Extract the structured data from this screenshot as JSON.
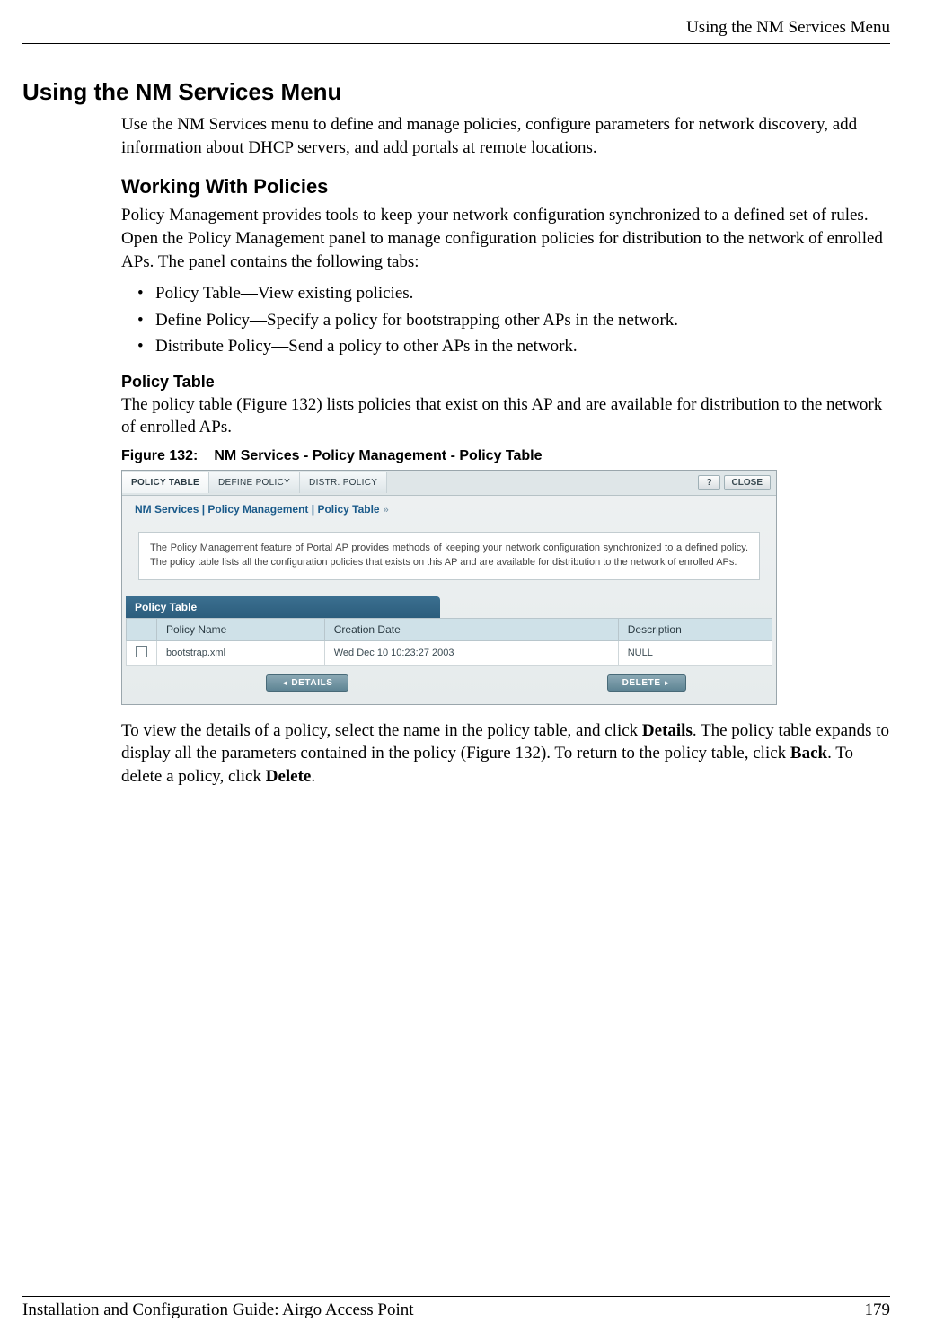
{
  "header": {
    "right": "Using the NM Services Menu"
  },
  "h1": "Using the NM Services Menu",
  "intro": "Use the NM Services menu to define and manage policies, configure parameters for network discovery, add information about DHCP servers, and add portals at remote locations.",
  "h2": "Working With Policies",
  "p2": "Policy Management provides tools to keep your network configuration synchronized to a defined set of rules. Open the Policy Management panel to manage configuration policies for distribution to the network of enrolled APs. The panel contains the following tabs:",
  "bullets": [
    "Policy Table—View existing policies.",
    "Define Policy—Specify a policy for bootstrapping other APs in the network.",
    "Distribute Policy—Send a policy to other APs in the network."
  ],
  "h3": "Policy Table",
  "p3": "The policy table (Figure 132) lists policies that exist on this AP and are available for distribution to the network of enrolled APs.",
  "figcap_label": "Figure 132:",
  "figcap_text": "NM Services - Policy Management - Policy Table",
  "panel": {
    "tabs": [
      "POLICY TABLE",
      "DEFINE POLICY",
      "DISTR. POLICY"
    ],
    "help": "?",
    "close": "CLOSE",
    "breadcrumb": "NM Services | Policy Management | Policy Table",
    "info": "The Policy Management feature of Portal AP provides methods of keeping your network configuration synchronized to a defined policy. The policy table lists all the configuration policies that exists on this AP and are available for distribution to the network of enrolled APs.",
    "section_title": "Policy Table",
    "columns": [
      "Policy Name",
      "Creation Date",
      "Description"
    ],
    "row": {
      "name": "bootstrap.xml",
      "date": "Wed Dec 10 10:23:27 2003",
      "desc": "NULL"
    },
    "btn_details": "DETAILS",
    "btn_delete": "DELETE"
  },
  "p4_pre": "To view the details of a policy, select the name in the policy table, and click ",
  "p4_b1": "Details",
  "p4_mid": ". The policy table expands to display all the parameters contained in the policy (Figure 132). To return to the policy table, click ",
  "p4_b2": "Back",
  "p4_mid2": ". To delete a policy, click ",
  "p4_b3": "Delete",
  "p4_end": ".",
  "footer": {
    "left": "Installation and Configuration Guide: Airgo Access Point",
    "right": "179"
  }
}
